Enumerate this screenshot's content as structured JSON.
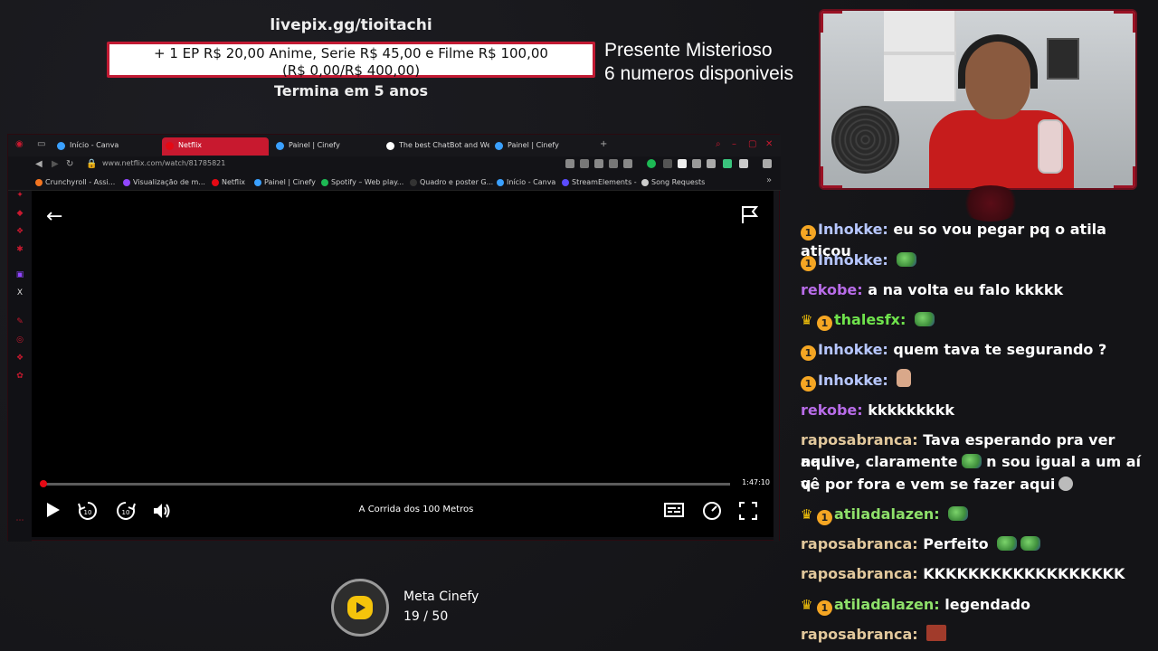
{
  "donation": {
    "url": "livepix.gg/tioitachi",
    "line1": "+ 1 EP R$ 20,00 Anime, Serie R$ 45,00 e Filme R$ 100,00",
    "line2": "(R$ 0,00/R$ 400,00)",
    "ends": "Termina em 5 anos"
  },
  "mystery": {
    "line1": "Presente Misterioso",
    "line2": "6 numeros disponiveis"
  },
  "browser": {
    "tabs": [
      {
        "label": "Início - Canva",
        "color": "#3aa0ff"
      },
      {
        "label": "Netflix",
        "color": "#e50914"
      },
      {
        "label": "Painel | Cinefy",
        "color": "#3aa0ff"
      },
      {
        "label": "The best ChatBot and We",
        "color": "#ffffff"
      },
      {
        "label": "Painel | Cinefy",
        "color": "#3aa0ff"
      }
    ],
    "address": "www.netflix.com/watch/81785821",
    "bookmarks": [
      {
        "label": "Crunchyroll - Assi...",
        "color": "#f47521"
      },
      {
        "label": "Visualização de m...",
        "color": "#9146ff"
      },
      {
        "label": "Netflix",
        "color": "#e50914"
      },
      {
        "label": "Painel | Cinefy",
        "color": "#3aa0ff"
      },
      {
        "label": "Spotify – Web play...",
        "color": "#1db954"
      },
      {
        "label": "Quadro e poster G...",
        "color": "#333333"
      },
      {
        "label": "Início - Canva",
        "color": "#3aa0ff"
      },
      {
        "label": "StreamElements -",
        "color": "#5a4bff"
      },
      {
        "label": "Song Requests",
        "color": "#cccccc"
      }
    ]
  },
  "player": {
    "duration": "1:47:10",
    "title": "A Corrida dos 100 Metros",
    "progress": 0.004
  },
  "meta": {
    "name": "Meta Cinefy",
    "count": "19  /  50"
  },
  "chat": [
    {
      "user": "Inhokke:",
      "text": "eu so vou pegar pq o atila atiçou",
      "badges": [
        "sub"
      ],
      "cls": "u-inhokke",
      "emote": ""
    },
    {
      "user": "Inhokke:",
      "text": "",
      "badges": [
        "sub"
      ],
      "cls": "u-inhokke",
      "emote": "frog"
    },
    {
      "user": "rekobe:",
      "text": "a na volta eu falo kkkkk",
      "badges": [],
      "cls": "u-rekobe",
      "emote": ""
    },
    {
      "user": "thalesfx:",
      "text": "",
      "badges": [
        "crown",
        "sub"
      ],
      "cls": "u-thales",
      "emote": "frog"
    },
    {
      "user": "Inhokke:",
      "text": "quem tava te segurando ?",
      "badges": [
        "sub"
      ],
      "cls": "u-inhokke",
      "emote": ""
    },
    {
      "user": "Inhokke:",
      "text": "",
      "badges": [
        "sub"
      ],
      "cls": "u-inhokke",
      "emote": "fist"
    },
    {
      "user": "rekobe:",
      "text": "kkkkkkkkk",
      "badges": [],
      "cls": "u-rekobe",
      "emote": ""
    },
    {
      "user": "raposabranca:",
      "text": "Tava esperando pra ver aqui",
      "badges": [],
      "cls": "u-rapos",
      "emote": ""
    },
    {
      "user": "",
      "text": "na live, claramente",
      "badges": [],
      "cls": "u-rapos",
      "emote": "frog",
      "after": "n sou igual a um aí q"
    },
    {
      "user": "",
      "text": "vê por fora e vem se fazer aqui",
      "badges": [],
      "cls": "u-rapos",
      "emote": "face"
    },
    {
      "user": "atiladalazen:",
      "text": "",
      "badges": [
        "crown",
        "sub"
      ],
      "cls": "u-atila",
      "emote": "frog"
    },
    {
      "user": "raposabranca:",
      "text": "Perfeito",
      "badges": [],
      "cls": "u-rapos",
      "emote": "frog2"
    },
    {
      "user": "raposabranca:",
      "text": "KKKKKKKKKKKKKKKKKK",
      "badges": [],
      "cls": "u-rapos",
      "emote": ""
    },
    {
      "user": "atiladalazen:",
      "text": "legendado",
      "badges": [
        "crown",
        "sub"
      ],
      "cls": "u-atila",
      "emote": ""
    },
    {
      "user": "raposabranca:",
      "text": "",
      "badges": [],
      "cls": "u-rapos",
      "emote": "pic"
    }
  ],
  "icons": {
    "badge_sub": "1",
    "crown": "♛"
  }
}
